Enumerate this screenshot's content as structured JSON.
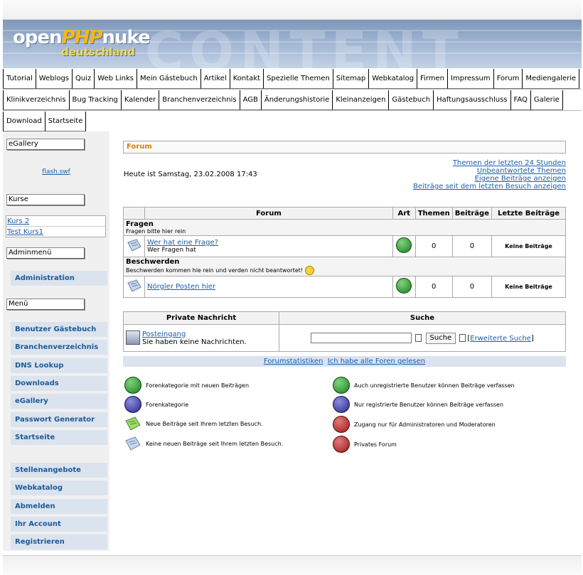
{
  "logo": {
    "part1": "open",
    "part2": "PHP",
    "part3": "nuke",
    "subtitle": "deutschland",
    "banner_text": "CONTENT"
  },
  "nav_row1": [
    "Tutorial",
    "Weblogs",
    "Quiz",
    "Web Links",
    "Mein Gästebuch",
    "Artikel",
    "Kontakt",
    "Spezielle Themen",
    "Sitemap",
    "Webkatalog",
    "Firmen",
    "Impressum",
    "Forum",
    "Mediengalerie"
  ],
  "nav_row2": [
    "Klinikverzeichnis",
    "Bug Tracking",
    "Kalender",
    "Branchenverzeichnis",
    "AGB",
    "Änderungshistorie",
    "Kleinanzeigen",
    "Gästebuch",
    "Haftungsausschluss",
    "FAQ",
    "Galerie"
  ],
  "nav_row3": [
    "Download",
    "Startseite"
  ],
  "sidebar": {
    "egallery_title": "eGallery",
    "flash_link": "flash.swf",
    "kurse_title": "Kurse",
    "kurse": [
      "Kurs 2",
      "Test Kurs1"
    ],
    "admin_title": "Adminmenü",
    "admin_items": [
      "Administration"
    ],
    "menu_title": "Menü",
    "menu_items": [
      "Benutzer Gästebuch",
      "Branchenverzeichnis",
      "DNS Lookup",
      "Downloads",
      "eGallery",
      "Passwort Generator",
      "Startseite"
    ],
    "menu_items2": [
      "Stellenangebote",
      "Webkatalog",
      "Abmelden",
      "Ihr Account",
      "Registrieren"
    ]
  },
  "main": {
    "title": "Forum",
    "today": "Heute ist Samstag, 23.02.2008 17:43",
    "links": [
      "Themen der letzten 24 Stunden",
      "Unbeantwortete Themen",
      "Eigene Beiträge anzeigen",
      "Beiträge seit dem letzten Besuch anzeigen"
    ]
  },
  "forum_table": {
    "headers": [
      "Forum",
      "Art",
      "Themen",
      "Beiträge",
      "Letzte Beiträge"
    ],
    "categories": [
      {
        "title": "Fragen",
        "desc": "Fragen bitte hier rein",
        "forum": "Wer hat eine Frage?",
        "forum_desc": "Wer Fragen hat",
        "topics": "0",
        "posts": "0",
        "last": "Keine Beiträge"
      },
      {
        "title": "Beschwerden",
        "desc": "Beschwerden kommen hie rein und verden nicht beantwortet!",
        "forum": "Nörgler Posten hier",
        "forum_desc": "",
        "topics": "0",
        "posts": "0",
        "last": "Keine Beiträge"
      }
    ]
  },
  "pm": {
    "header_pm": "Private Nachricht",
    "header_search": "Suche",
    "inbox_link": "Posteingang",
    "inbox_text": "Sie haben keine Nachrichten.",
    "search_button": "Suche",
    "advanced_search": "Erweiterte Suche",
    "bracket_open": "[",
    "bracket_close": "]",
    "footer_links": [
      "Forumstatistiken",
      "Ich habe alle Foren gelesen"
    ]
  },
  "legend": [
    "Forenkategorie mit neuen Beiträgen",
    "Forenkategorie",
    "Neue Beiträge seit Ihrem letzten Besuch.",
    "Keine neuen Beiträge seit Ihrem letzten Besuch.",
    "Auch unregistrierte Benutzer können Beiträge verfassen",
    "Nur registrierte Benutzer können Beiträge verfassen",
    "Zugang nur für Administratoren und Moderatoren",
    "Privates Forum"
  ],
  "colors": {
    "accent_link": "#1d5ea8",
    "forum_title": "#d4820a",
    "sidebar_item_bg": "#dbe3ee",
    "green_icon": "#1f7f1f",
    "blue_icon": "#2a2a8a",
    "red_icon": "#a01818"
  }
}
